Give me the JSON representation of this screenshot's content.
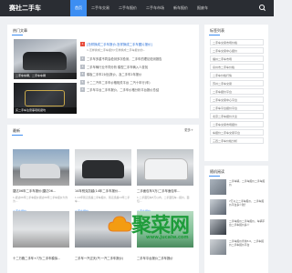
{
  "site": {
    "logo": "赛社二手车"
  },
  "nav": [
    {
      "label": "首页",
      "active": true
    },
    {
      "label": "二手车交易"
    },
    {
      "label": "二手车报价"
    },
    {
      "label": "二手车市场"
    },
    {
      "label": "新车报价"
    },
    {
      "label": "报废车"
    }
  ],
  "hot": {
    "title": "热门文章",
    "feature_caption": "二手车车辆，二手车车辆",
    "feature2_caption": "买二手车注意事项和避坑",
    "head_title": "[怎样换成二手车报价-怎样换成二手车图片报价]",
    "head_desc": "1.怎样换成二手车报价?怎样换成二手车报价的...",
    "items": [
      {
        "num": "2",
        "title": "二手车多重不同会检测多次检测，二手车的理论检测报告"
      },
      {
        "num": "3",
        "title": "二手车辆行业不同分析 模型二手车辆入人查找"
      },
      {
        "num": "4",
        "title": "模板二手车2对比报价，及二手车2年报价"
      },
      {
        "num": "5",
        "title": "十二二汽车二手车价格相关平台 二汽十年行(车)"
      },
      {
        "num": "6",
        "title": "二手车平台二手车报价，二手车价格分析平台报价总结"
      }
    ]
  },
  "latest": {
    "title": "最新",
    "more": "更多+",
    "cards": [
      {
        "title": "捷达06年二手车报价(捷达06...",
        "desc": "1.捷达06年二手车报价捷达06年二手车报价大约为...",
        "tag": "二手车报价"
      },
      {
        "title": "14年别克凯越(14年二手车报价...",
        "desc": "1.14年别克凯越二手车报价，别克凯越14年二手车...",
        "tag": "二手车报价"
      },
      {
        "title": "二手面包车5万(二手车面包车...",
        "desc": "1.二手面包车5万以内，二手面包车...报价，面包...",
        "tag": "二手车报价"
      }
    ],
    "row2_titles": [
      "十二万跑二手车+7万(二手车模拟...",
      "二手车一汽过天(汽·一汽二手车报价)",
      "二手车平台报价二手车报价"
    ]
  },
  "tags": {
    "title": "标签列表",
    "items": [
      "二手车交易市场价格",
      "二手车交易中心报价",
      "福州二手车市场",
      "泉州市二手车价格",
      "二手车价格行情",
      "苏州二手车交易",
      "二手车报价平台",
      "二手车交易中心平台",
      "二手车平台报价平台",
      "北京二手车报价大全",
      "二手车交易市场报价",
      "车报价二手车交易平台",
      "三四二手车价格分析"
    ]
  },
  "recommend": {
    "title": "随机阅读",
    "items": [
      "二手车辆，二手车报价二手车报价",
      "7万以上二手车报价，二手车报价平台多少钱？",
      "二手车报价二手车报价，车辆平台二手车报价多少",
      "二手车报价查询3.0，二手车报价二手车报价平台"
    ]
  },
  "watermark": {
    "text": "聚菜网",
    "url": "www.jucaiw.com"
  },
  "colors": {
    "accent": "#3d8ef2",
    "nav_bg": "#2a2d33",
    "watermark_green": "#1e9c3a"
  }
}
